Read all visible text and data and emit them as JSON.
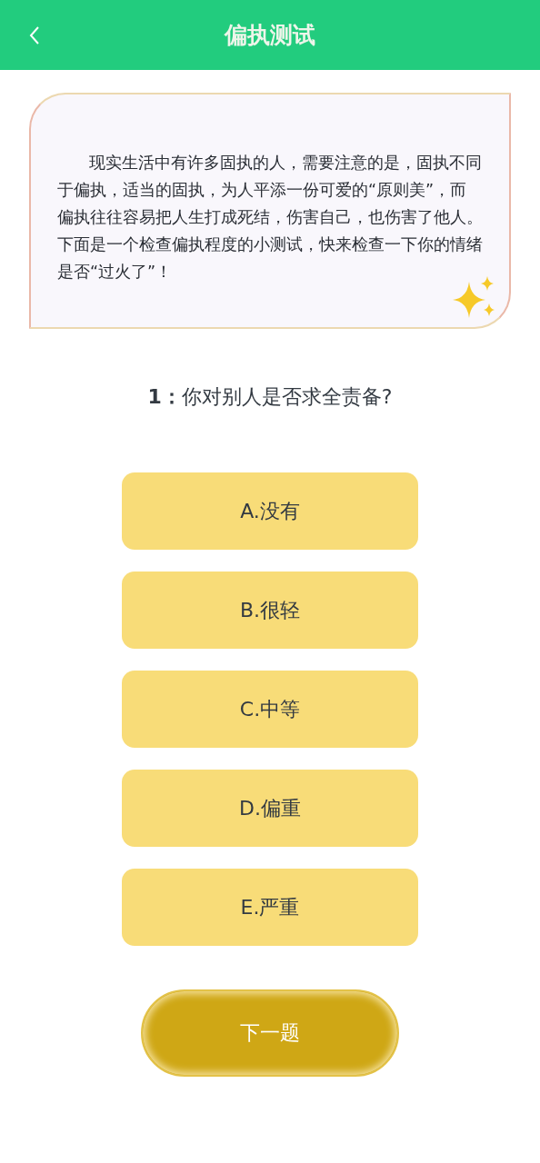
{
  "header": {
    "title": "偏执测试"
  },
  "intro": "现实生活中有许多固执的人，需要注意的是，固执不同于偏执，适当的固执，为人平添一份可爱的“原则美”，而偏执往往容易把人生打成死结，伤害自己，也伤害了他人。下面是一个检查偏执程度的小测试，快来检查一下你的情绪是否“过火了”！",
  "question": {
    "number": "1：",
    "text": "你对别人是否求全责备?"
  },
  "options": [
    "A.没有",
    "B.很轻",
    "C.中等",
    "D.偏重",
    "E.严重"
  ],
  "next_button": "下一题"
}
